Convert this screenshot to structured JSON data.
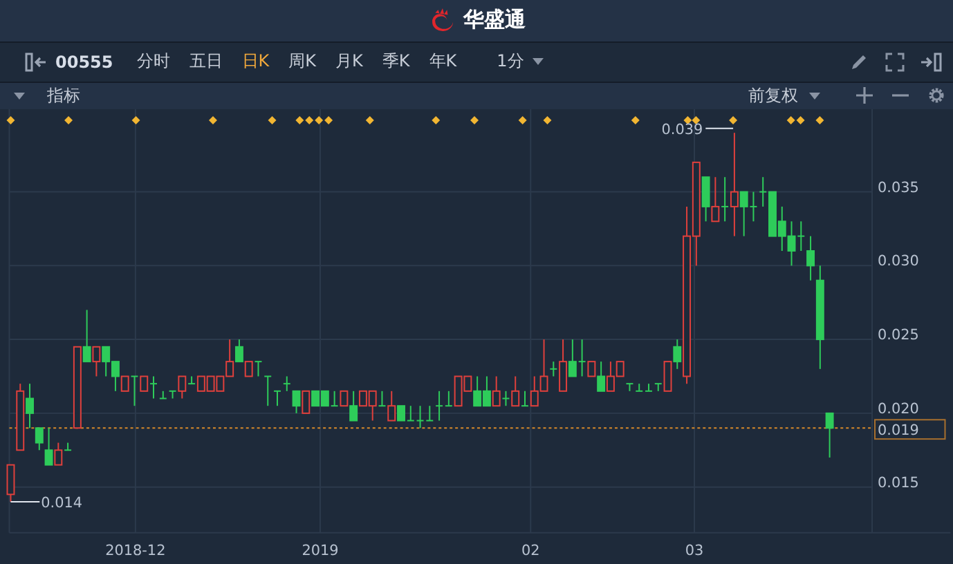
{
  "header": {
    "logo_text": "华盛通"
  },
  "toolbar": {
    "stock_code": "00555",
    "tabs": [
      {
        "label": "分时",
        "selected": false
      },
      {
        "label": "五日",
        "selected": false
      },
      {
        "label": "日K",
        "selected": true
      },
      {
        "label": "周K",
        "selected": false
      },
      {
        "label": "月K",
        "selected": false
      },
      {
        "label": "季K",
        "selected": false
      },
      {
        "label": "年K",
        "selected": false
      }
    ],
    "interval": "1分"
  },
  "indicator_bar": {
    "label": "指标",
    "adjustment": "前复权"
  },
  "chart": {
    "low_label": "0.014",
    "high_label": "0.039",
    "x_axis_labels": [
      "2018-12",
      "2019",
      "02",
      "03"
    ],
    "chart_data": {
      "type": "candlestick",
      "ylim": [
        0.0119,
        0.0406
      ],
      "grid": true,
      "ref_lines": [
        {
          "axis": "y",
          "value": 0.019,
          "label": "0.019",
          "color": "#d6892a"
        }
      ],
      "yticks": [
        {
          "value": 0.035,
          "label": "0.035"
        },
        {
          "value": 0.03,
          "label": "0.030"
        },
        {
          "value": 0.025,
          "label": "0.025"
        },
        {
          "value": 0.02,
          "label": "0.020"
        },
        {
          "value": 0.015,
          "label": "0.015"
        }
      ],
      "ohlc": [
        [
          0.0145,
          0.0165,
          0.014,
          0.0165
        ],
        [
          0.0175,
          0.022,
          0.0175,
          0.0215
        ],
        [
          0.021,
          0.022,
          0.019,
          0.02
        ],
        [
          0.019,
          0.019,
          0.0175,
          0.018
        ],
        [
          0.0175,
          0.019,
          0.0165,
          0.0165
        ],
        [
          0.0165,
          0.018,
          0.0165,
          0.0175
        ],
        [
          0.0175,
          0.018,
          0.0175,
          0.0175
        ],
        [
          0.019,
          0.0245,
          0.019,
          0.0245
        ],
        [
          0.0245,
          0.027,
          0.0235,
          0.0235
        ],
        [
          0.0235,
          0.0245,
          0.0225,
          0.0245
        ],
        [
          0.0245,
          0.0245,
          0.0225,
          0.0235
        ],
        [
          0.0235,
          0.0235,
          0.0215,
          0.0225
        ],
        [
          0.0215,
          0.0225,
          0.0215,
          0.0225
        ],
        [
          0.0225,
          0.0225,
          0.0205,
          0.0225
        ],
        [
          0.0215,
          0.0225,
          0.0215,
          0.0225
        ],
        [
          0.022,
          0.0225,
          0.021,
          0.022
        ],
        [
          0.021,
          0.0215,
          0.021,
          0.021
        ],
        [
          0.0215,
          0.0215,
          0.021,
          0.0215
        ],
        [
          0.0215,
          0.0225,
          0.021,
          0.0225
        ],
        [
          0.022,
          0.0225,
          0.022,
          0.022
        ],
        [
          0.0215,
          0.0225,
          0.0215,
          0.0225
        ],
        [
          0.0215,
          0.0225,
          0.0215,
          0.0225
        ],
        [
          0.0215,
          0.0225,
          0.0215,
          0.0225
        ],
        [
          0.0225,
          0.025,
          0.0225,
          0.0235
        ],
        [
          0.0245,
          0.025,
          0.0235,
          0.0235
        ],
        [
          0.0225,
          0.0235,
          0.0225,
          0.0235
        ],
        [
          0.0235,
          0.0235,
          0.0225,
          0.0235
        ],
        [
          0.0225,
          0.0225,
          0.0205,
          0.0225
        ],
        [
          0.0215,
          0.0215,
          0.0205,
          0.0215
        ],
        [
          0.022,
          0.0225,
          0.0215,
          0.022
        ],
        [
          0.0215,
          0.0215,
          0.02,
          0.0205
        ],
        [
          0.02,
          0.0215,
          0.02,
          0.0215
        ],
        [
          0.0215,
          0.0215,
          0.0205,
          0.0205
        ],
        [
          0.0215,
          0.0215,
          0.0205,
          0.0205
        ],
        [
          0.0205,
          0.0215,
          0.0205,
          0.0205
        ],
        [
          0.0205,
          0.0215,
          0.0205,
          0.0215
        ],
        [
          0.0205,
          0.0215,
          0.0195,
          0.0195
        ],
        [
          0.0205,
          0.0215,
          0.0205,
          0.0215
        ],
        [
          0.0205,
          0.0215,
          0.0195,
          0.0215
        ],
        [
          0.0205,
          0.0215,
          0.0205,
          0.0205
        ],
        [
          0.0195,
          0.0215,
          0.0195,
          0.0205
        ],
        [
          0.0205,
          0.0205,
          0.0195,
          0.0195
        ],
        [
          0.0195,
          0.0205,
          0.0195,
          0.0195
        ],
        [
          0.0195,
          0.0205,
          0.019,
          0.0195
        ],
        [
          0.0195,
          0.0205,
          0.0195,
          0.0195
        ],
        [
          0.0205,
          0.0215,
          0.0195,
          0.0205
        ],
        [
          0.0205,
          0.0215,
          0.0205,
          0.0205
        ],
        [
          0.0205,
          0.0225,
          0.0205,
          0.0225
        ],
        [
          0.0215,
          0.0225,
          0.0215,
          0.0225
        ],
        [
          0.0215,
          0.0225,
          0.0205,
          0.0205
        ],
        [
          0.0215,
          0.0225,
          0.0205,
          0.0205
        ],
        [
          0.0205,
          0.0225,
          0.0205,
          0.0215
        ],
        [
          0.021,
          0.0215,
          0.0205,
          0.021
        ],
        [
          0.0205,
          0.0225,
          0.0205,
          0.0215
        ],
        [
          0.0205,
          0.0215,
          0.0205,
          0.0205
        ],
        [
          0.0205,
          0.0225,
          0.0205,
          0.0215
        ],
        [
          0.0215,
          0.025,
          0.0215,
          0.0225
        ],
        [
          0.023,
          0.0235,
          0.0225,
          0.023
        ],
        [
          0.0215,
          0.025,
          0.0215,
          0.0235
        ],
        [
          0.0235,
          0.025,
          0.0225,
          0.0225
        ],
        [
          0.0235,
          0.025,
          0.0225,
          0.0235
        ],
        [
          0.0225,
          0.0235,
          0.0225,
          0.0235
        ],
        [
          0.0225,
          0.0235,
          0.0215,
          0.0215
        ],
        [
          0.0215,
          0.0235,
          0.0215,
          0.0225
        ],
        [
          0.0225,
          0.0235,
          0.0225,
          0.0235
        ],
        [
          0.022,
          0.022,
          0.0215,
          0.022
        ],
        [
          0.0215,
          0.022,
          0.0215,
          0.0215
        ],
        [
          0.0215,
          0.022,
          0.0215,
          0.0215
        ],
        [
          0.022,
          0.022,
          0.0215,
          0.022
        ],
        [
          0.0215,
          0.0235,
          0.0215,
          0.0235
        ],
        [
          0.0245,
          0.025,
          0.023,
          0.0235
        ],
        [
          0.0225,
          0.034,
          0.022,
          0.032
        ],
        [
          0.032,
          0.037,
          0.03,
          0.037
        ],
        [
          0.036,
          0.036,
          0.033,
          0.034
        ],
        [
          0.033,
          0.036,
          0.033,
          0.034
        ],
        [
          0.034,
          0.036,
          0.033,
          0.034
        ],
        [
          0.034,
          0.039,
          0.032,
          0.035
        ],
        [
          0.035,
          0.035,
          0.032,
          0.034
        ],
        [
          0.034,
          0.035,
          0.033,
          0.034
        ],
        [
          0.035,
          0.036,
          0.034,
          0.035
        ],
        [
          0.035,
          0.035,
          0.032,
          0.032
        ],
        [
          0.033,
          0.034,
          0.031,
          0.032
        ],
        [
          0.032,
          0.033,
          0.03,
          0.031
        ],
        [
          0.032,
          0.033,
          0.031,
          0.032
        ],
        [
          0.031,
          0.032,
          0.029,
          0.03
        ],
        [
          0.029,
          0.03,
          0.023,
          0.025
        ],
        [
          0.02,
          0.02,
          0.017,
          0.019
        ]
      ]
    }
  }
}
